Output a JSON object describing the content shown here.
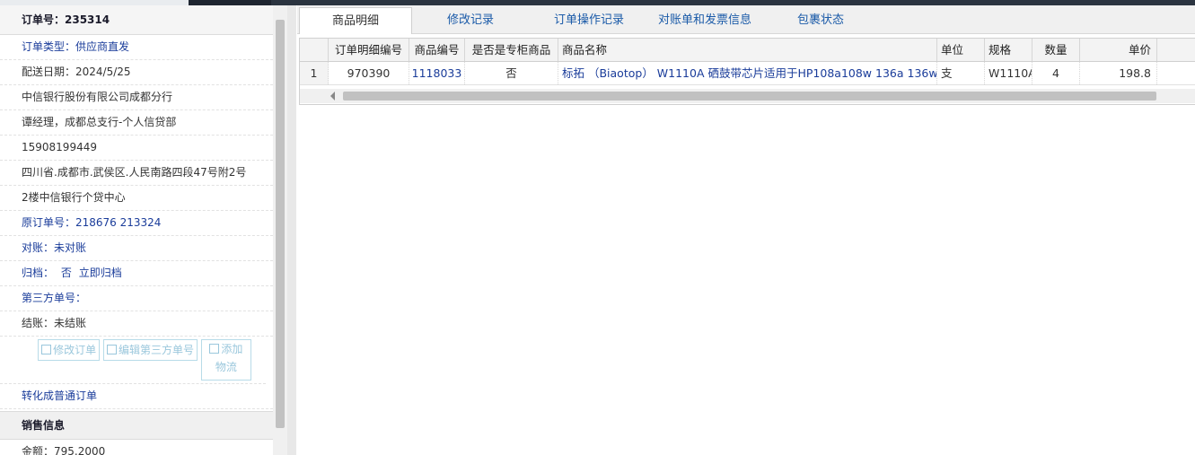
{
  "order": {
    "order_no": "订单号：235314",
    "order_type": "订单类型：供应商直发",
    "delivery_date": "配送日期：2024/5/25",
    "company": "中信银行股份有限公司成都分行",
    "contact": "谭经理，成都总支行-个人信贷部",
    "phone": "15908199449",
    "address_1": "四川省.成都市.武侯区.人民南路四段47号附2号",
    "address_2": "2楼中信银行个贷中心",
    "original_order": "原订单号：218676 213324",
    "reconcile": "对账：未对账",
    "archive_label": "归档：",
    "archive_value": "否",
    "archive_link": "立即归档",
    "third_party_no": "第三方单号：",
    "settlement": "结账：未结账",
    "btn_edit_order": "修改订单",
    "btn_edit_third": "编辑第三方单号",
    "btn_add_logistics": "添加物流",
    "convert_link": "转化成普通订单",
    "sales_section": "销售信息",
    "amount": "金额：795.2000"
  },
  "tabs": [
    {
      "label": "商品明细"
    },
    {
      "label": "修改记录"
    },
    {
      "label": "订单操作记录"
    },
    {
      "label": "对账单和发票信息"
    },
    {
      "label": "包裹状态"
    }
  ],
  "table": {
    "headers": [
      "",
      "订单明细编号",
      "商品编号",
      "是否是专柜商品",
      "商品名称",
      "单位",
      "规格",
      "数量",
      "单价"
    ],
    "rows": [
      [
        "1",
        "970390",
        "1118033",
        "否",
        "标拓 （Biaotop） W1110A 硒鼓带芯片适用于HP108a108w 136a 136w 13",
        "支",
        "W1110A",
        "4",
        "198.8"
      ]
    ]
  }
}
